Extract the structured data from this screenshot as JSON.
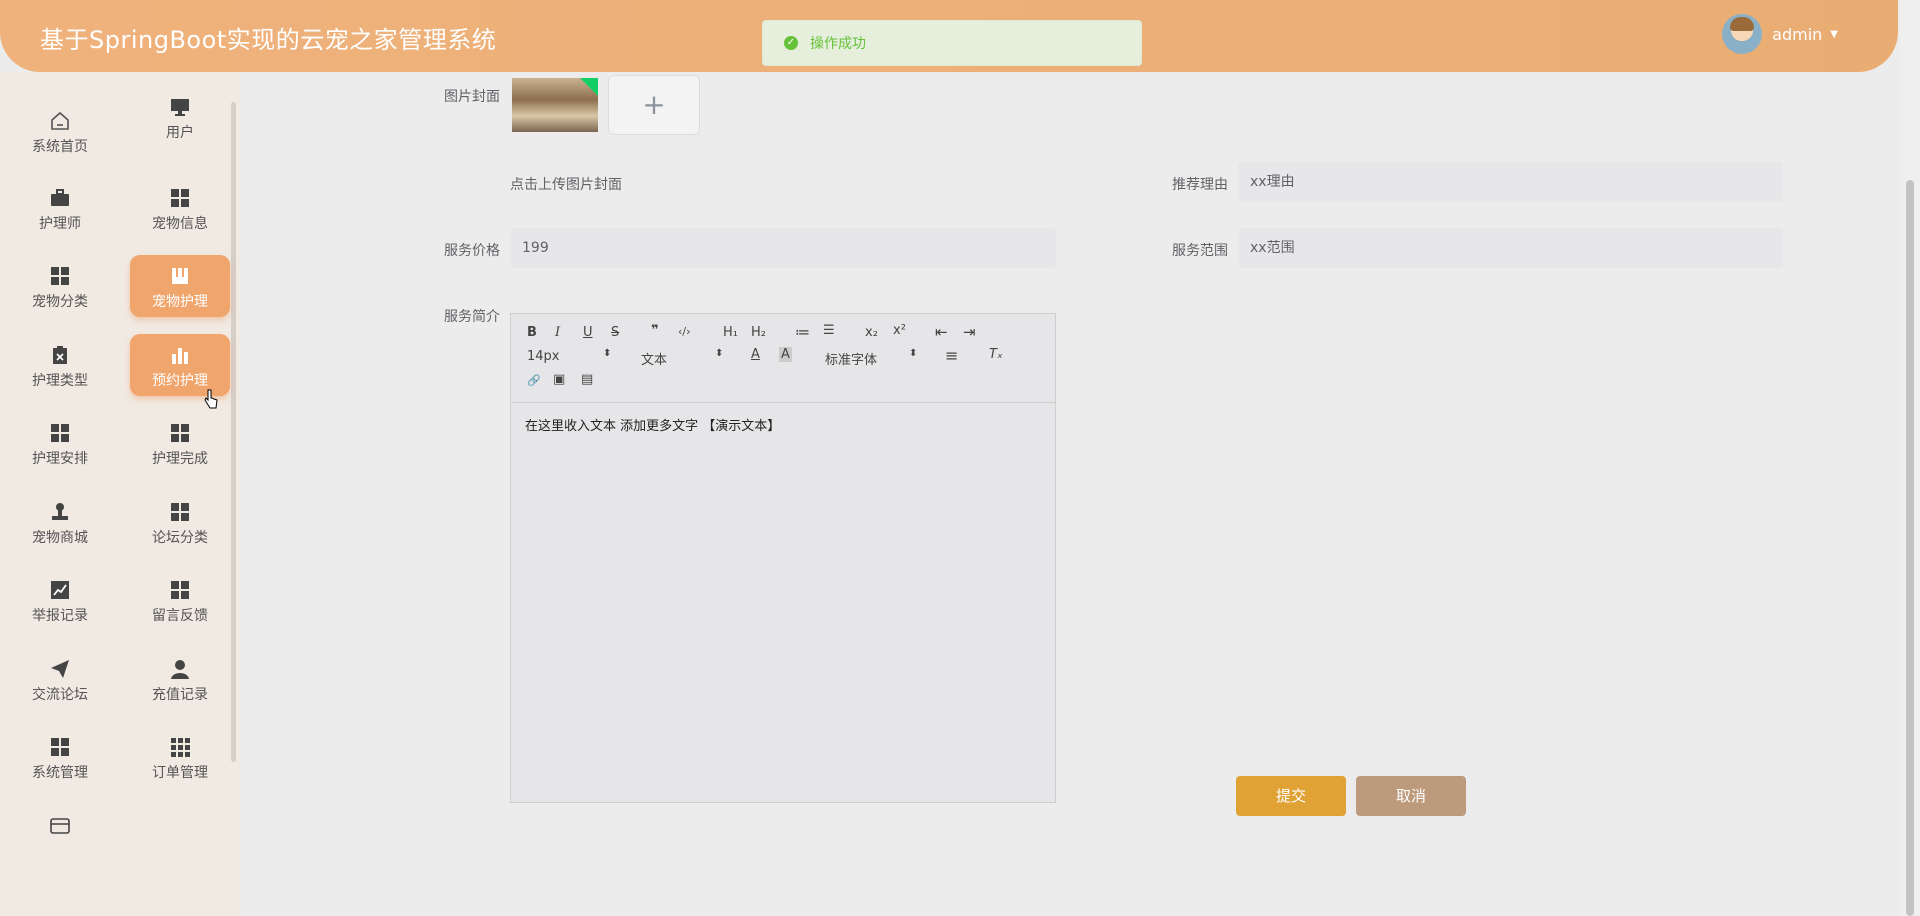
{
  "header": {
    "title": "基于SpringBoot实现的云宠之家管理系统",
    "username": "admin"
  },
  "toast": {
    "message": "操作成功"
  },
  "sidebar": {
    "items": [
      {
        "label": "系统首页",
        "icon": "home-icon"
      },
      {
        "label": "用户",
        "icon": "monitor-icon"
      },
      {
        "label": "护理师",
        "icon": "briefcase-icon"
      },
      {
        "label": "宠物信息",
        "icon": "grid-icon"
      },
      {
        "label": "宠物分类",
        "icon": "grid-icon"
      },
      {
        "label": "宠物护理",
        "icon": "book-icon",
        "active": true
      },
      {
        "label": "护理类型",
        "icon": "clipboard-icon"
      },
      {
        "label": "预约护理",
        "icon": "bar-chart-icon",
        "active": true
      },
      {
        "label": "护理安排",
        "icon": "grid-icon"
      },
      {
        "label": "护理完成",
        "icon": "grid-icon"
      },
      {
        "label": "宠物商城",
        "icon": "stamp-icon"
      },
      {
        "label": "论坛分类",
        "icon": "grid-icon"
      },
      {
        "label": "举报记录",
        "icon": "line-chart-icon"
      },
      {
        "label": "留言反馈",
        "icon": "grid-icon"
      },
      {
        "label": "交流论坛",
        "icon": "send-icon"
      },
      {
        "label": "充值记录",
        "icon": "user-icon"
      },
      {
        "label": "系统管理",
        "icon": "grid-icon"
      },
      {
        "label": "订单管理",
        "icon": "apps-icon"
      },
      {
        "label": "",
        "icon": "card-icon"
      }
    ]
  },
  "form": {
    "cover_label": "图片封面",
    "upload_hint": "点击上传图片封面",
    "upload_plus": "+",
    "reason_label": "推荐理由",
    "reason_value": "xx理由",
    "price_label": "服务价格",
    "price_value": "199",
    "scope_label": "服务范围",
    "scope_value": "xx范围",
    "intro_label": "服务简介"
  },
  "editor": {
    "font_size": "14px",
    "block_type": "文本",
    "font_family": "标准字体",
    "content": "在这里收入文本 添加更多文字 【演示文本】",
    "tools": {
      "bold": "B",
      "italic": "I",
      "underline": "U",
      "strike": "S",
      "quote": "❞",
      "code": "‹/›",
      "h1": "H₁",
      "h2": "H₂",
      "ordered": "≔",
      "bullet": "☰",
      "sub": "x₂",
      "sup": "x²",
      "outdent": "⇤",
      "indent": "⇥",
      "color": "A",
      "bg": "A",
      "align": "≡",
      "clean": "Tₓ",
      "link": "🔗",
      "image": "▣",
      "video": "▤"
    }
  },
  "buttons": {
    "submit": "提交",
    "cancel": "取消"
  }
}
